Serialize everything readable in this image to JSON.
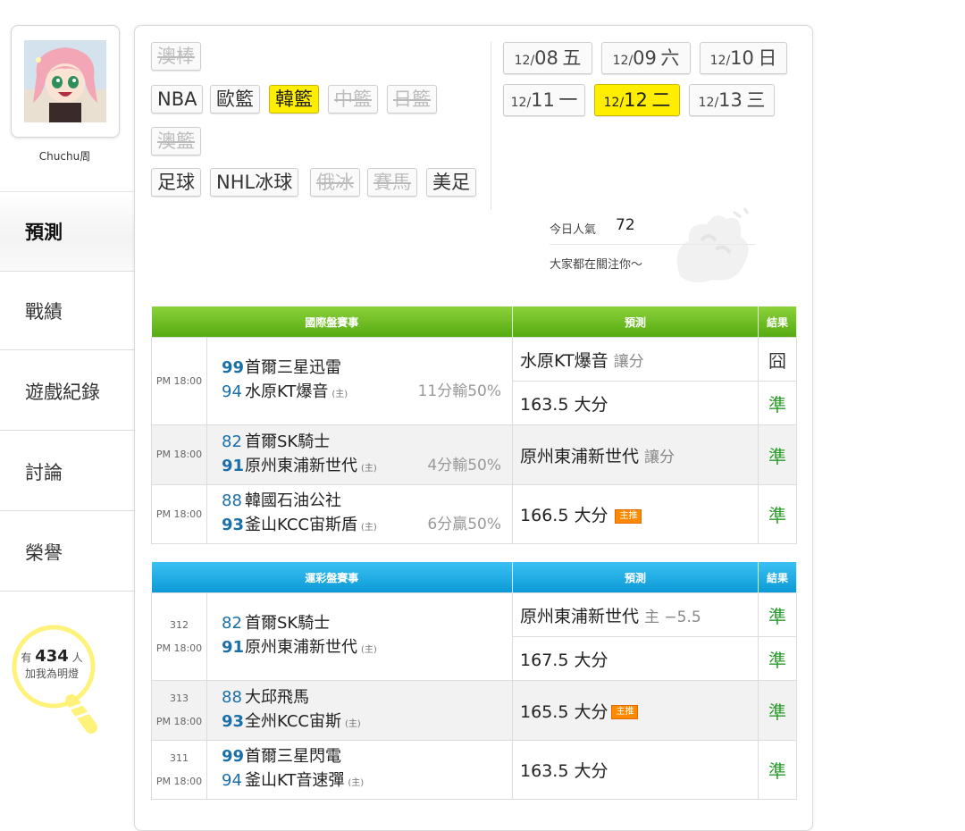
{
  "user": {
    "name": "Chuchu周"
  },
  "nav": [
    "預測",
    "戰績",
    "遊戲紀錄",
    "討論",
    "榮譽"
  ],
  "follow": {
    "prefix": "有",
    "count": "434",
    "suffix": "人",
    "line2": "加我為明燈"
  },
  "sports": {
    "row1": [
      {
        "label": "澳棒",
        "state": "disabled"
      }
    ],
    "row2": [
      {
        "label": "NBA",
        "state": "normal"
      },
      {
        "label": "歐籃",
        "state": "normal"
      },
      {
        "label": "韓籃",
        "state": "active"
      },
      {
        "label": "中籃",
        "state": "disabled"
      },
      {
        "label": "日籃",
        "state": "disabled"
      }
    ],
    "row3": [
      {
        "label": "澳籃",
        "state": "disabled"
      }
    ],
    "row4": [
      {
        "label": "足球",
        "state": "normal"
      },
      {
        "label": "NHL冰球",
        "state": "normal"
      },
      {
        "label": "俄冰",
        "state": "disabled"
      },
      {
        "label": "賽馬",
        "state": "disabled"
      },
      {
        "label": "美足",
        "state": "normal"
      }
    ]
  },
  "dates": [
    {
      "md": "12/",
      "day": "08",
      "wd": "五",
      "active": false
    },
    {
      "md": "12/",
      "day": "09",
      "wd": "六",
      "active": false
    },
    {
      "md": "12/",
      "day": "10",
      "wd": "日",
      "active": false
    },
    {
      "md": "12/",
      "day": "11",
      "wd": "一",
      "active": false
    },
    {
      "md": "12/",
      "day": "12",
      "wd": "二",
      "active": true
    },
    {
      "md": "12/",
      "day": "13",
      "wd": "三",
      "active": false
    }
  ],
  "popularity": {
    "label": "今日人氣",
    "value": "72",
    "subtitle": "大家都在關注你～"
  },
  "intl": {
    "headers": [
      "國際盤賽事",
      "預測",
      "結果"
    ],
    "games": [
      {
        "time": "PM 18:00",
        "away_score": "99",
        "away": "首爾三星迅雷",
        "home_score": "94",
        "home": "水原KT爆音",
        "host": "(主)",
        "odds": "11分輸50%",
        "winner": "away",
        "preds": [
          {
            "text": "水原KT爆音",
            "sub": "讓分",
            "badge": "",
            "result": "囧"
          },
          {
            "text": "163.5 大分",
            "sub": "",
            "badge": "",
            "result": "準"
          }
        ]
      },
      {
        "time": "PM 18:00",
        "away_score": "82",
        "away": "首爾SK騎士",
        "home_score": "91",
        "home": "原州東浦新世代",
        "host": "(主)",
        "odds": "4分輸50%",
        "winner": "home",
        "preds": [
          {
            "text": "原州東浦新世代",
            "sub": "讓分",
            "badge": "",
            "result": "準"
          }
        ]
      },
      {
        "time": "PM 18:00",
        "away_score": "88",
        "away": "韓國石油公社",
        "home_score": "93",
        "home": "釜山KCC宙斯盾",
        "host": "(主)",
        "odds": "6分贏50%",
        "winner": "home",
        "preds": [
          {
            "text": "166.5 大分",
            "sub": "",
            "badge": "主推",
            "result": "準"
          }
        ]
      }
    ]
  },
  "sportslottery": {
    "headers": [
      "運彩盤賽事",
      "預測",
      "結果"
    ],
    "games": [
      {
        "num": "312",
        "time": "PM 18:00",
        "away_score": "82",
        "away": "首爾SK騎士",
        "home_score": "91",
        "home": "原州東浦新世代",
        "host": "(主)",
        "winner": "home",
        "preds": [
          {
            "text": "原州東浦新世代",
            "sub": "主 −5.5",
            "badge": "",
            "result": "準"
          },
          {
            "text": "167.5 大分",
            "sub": "",
            "badge": "",
            "result": "準"
          }
        ]
      },
      {
        "num": "313",
        "time": "PM 18:00",
        "away_score": "88",
        "away": "大邱飛馬",
        "home_score": "93",
        "home": "全州KCC宙斯",
        "host": "(主)",
        "winner": "home",
        "preds": [
          {
            "text": "165.5 大分",
            "sub": "",
            "badge": "主推",
            "result": "準"
          }
        ]
      },
      {
        "num": "311",
        "time": "PM 18:00",
        "away_score": "99",
        "away": "首爾三星閃電",
        "home_score": "94",
        "home": "釜山KT音速彈",
        "host": "(主)",
        "winner": "away",
        "preds": [
          {
            "text": "163.5 大分",
            "sub": "",
            "badge": "",
            "result": "準"
          }
        ]
      }
    ]
  },
  "colors": {
    "active_yellow": "#ffee00",
    "intl_header": "#6cbf1f",
    "lottery_header": "#19a9e4",
    "correct": "#2a9b2a",
    "score": "#1a6fa8"
  }
}
